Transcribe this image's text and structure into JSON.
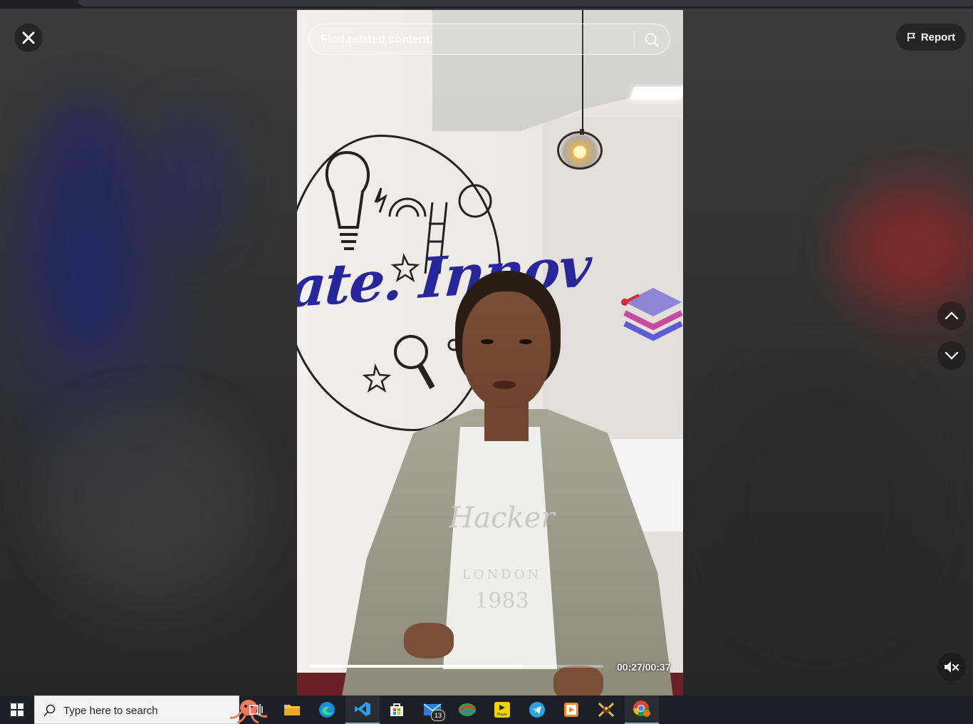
{
  "viewer": {
    "close_label": "Close",
    "report_label": "Report",
    "search": {
      "placeholder": "Find related content",
      "value": ""
    },
    "video": {
      "time_display": "00:27/00:37",
      "progress": 0.73,
      "wall_text": "ate. Innov",
      "tshirt_text": "Hacker",
      "tshirt_sub": "LONDON",
      "tshirt_year": "1983"
    }
  },
  "taskbar": {
    "search_placeholder": "Type here to search",
    "apps": [
      {
        "name": "task-view",
        "icon": "task-view-icon"
      },
      {
        "name": "file-explorer",
        "icon": "folder-icon"
      },
      {
        "name": "edge",
        "icon": "edge-icon"
      },
      {
        "name": "vscode",
        "icon": "vscode-icon"
      },
      {
        "name": "store",
        "icon": "store-icon"
      },
      {
        "name": "mail",
        "icon": "mail-icon",
        "badge": "13"
      },
      {
        "name": "photos",
        "icon": "photos-icon"
      },
      {
        "name": "player",
        "icon": "player-icon",
        "label": "Player"
      },
      {
        "name": "telegram",
        "icon": "telegram-icon"
      },
      {
        "name": "media",
        "icon": "media-icon"
      },
      {
        "name": "game",
        "icon": "game-icon"
      },
      {
        "name": "chrome",
        "icon": "chrome-icon"
      }
    ]
  },
  "colors": {
    "taskbar": "#1c1f26",
    "accent": "#7aa7e6",
    "wall_text": "#27279b"
  }
}
